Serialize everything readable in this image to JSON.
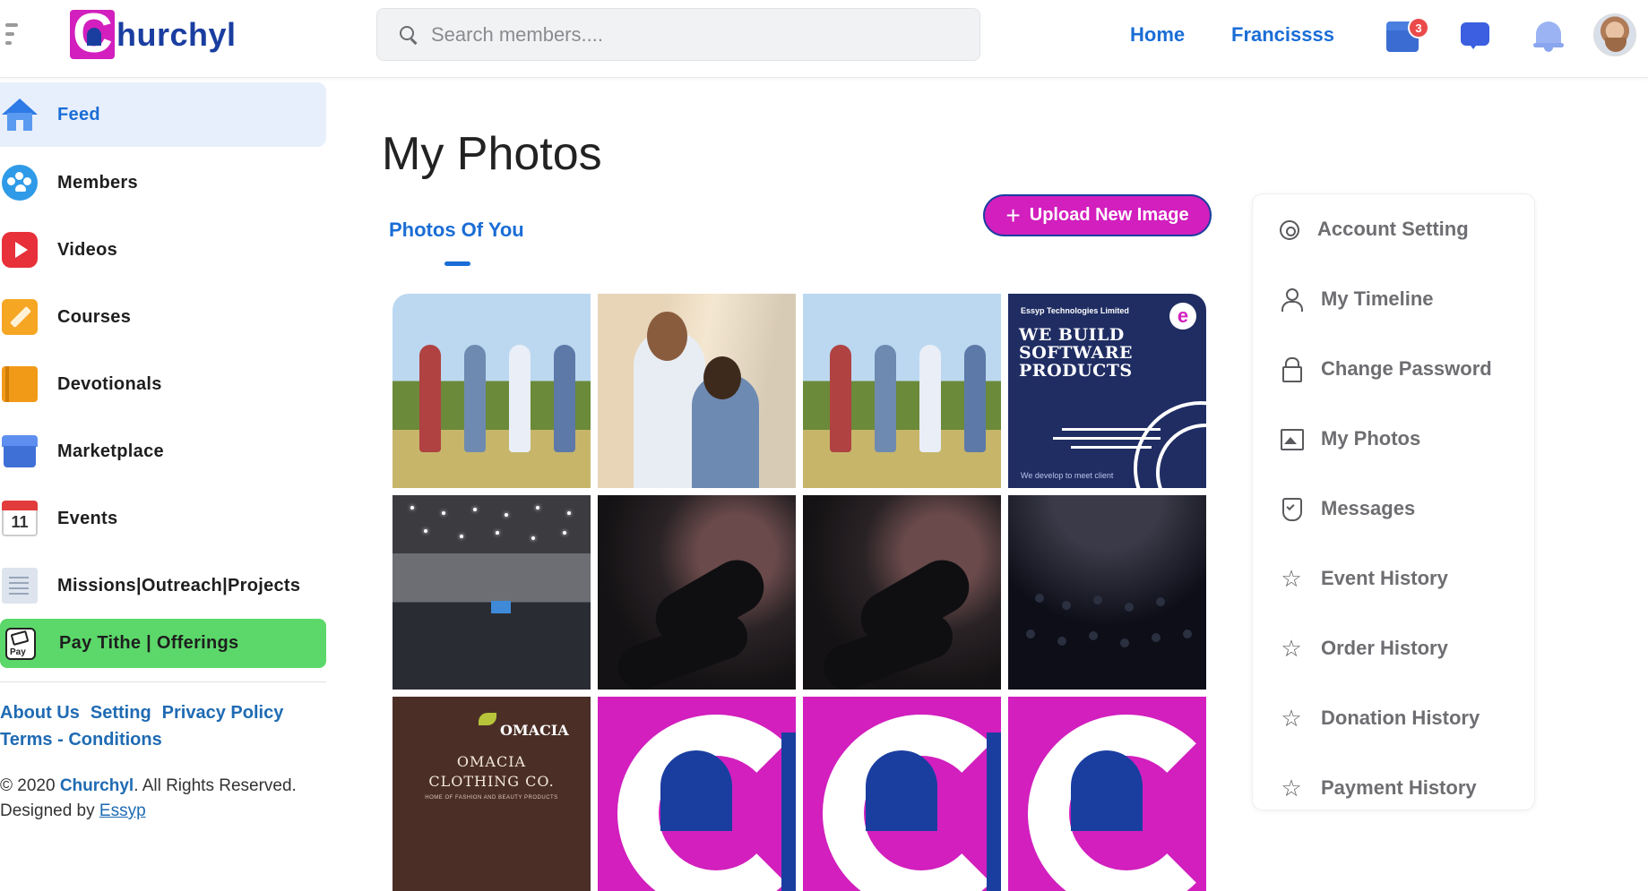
{
  "header": {
    "logo_text": "hurchyl",
    "logo_initial": "C",
    "search_placeholder": "Search members....",
    "nav": {
      "home": "Home",
      "user": "Francissss"
    },
    "store_badge_count": "3"
  },
  "sidebar": {
    "items": [
      {
        "label": "Feed",
        "icon": "home-icon"
      },
      {
        "label": "Members",
        "icon": "members-icon"
      },
      {
        "label": "Videos",
        "icon": "videos-icon"
      },
      {
        "label": "Courses",
        "icon": "courses-icon"
      },
      {
        "label": "Devotionals",
        "icon": "book-icon"
      },
      {
        "label": "Marketplace",
        "icon": "store-icon"
      },
      {
        "label": "Events",
        "icon": "calendar-icon",
        "calendar_day": "11"
      },
      {
        "label": "Missions|Outreach|Projects",
        "icon": "document-icon"
      },
      {
        "label": "Pay Tithe | Offerings",
        "icon": "pay-icon",
        "icon_text": "Pay"
      }
    ],
    "footer_links": [
      "About Us",
      "Setting",
      "Privacy Policy",
      "Terms - Conditions"
    ],
    "copyright_prefix": "© 2020",
    "copyright_brand": "Churchyl",
    "copyright_suffix": ". All Rights Reserved.",
    "designed_by_prefix": "Designed by",
    "designed_by_link": "Essyp"
  },
  "main": {
    "title": "My Photos",
    "tab_label": "Photos Of You",
    "upload_button": "Upload New Image",
    "photo_texts": {
      "ad_company": "Essyp Technologies Limited",
      "ad_headline_1": "WE BUILD",
      "ad_headline_2": "SOFTWARE",
      "ad_headline_3": "PRODUCTS",
      "ad_sub": "We develop to meet client",
      "omacia_logo": "OMACIA",
      "omacia_line_1": "OMACIA",
      "omacia_line_2": "CLOTHING CO.",
      "omacia_tagline": "HOME OF FASHION AND BEAUTY PRODUCTS"
    }
  },
  "account_menu": {
    "items": [
      {
        "label": "Account Setting",
        "icon": "gear-icon"
      },
      {
        "label": "My Timeline",
        "icon": "user-icon"
      },
      {
        "label": "Change Password",
        "icon": "lock-icon"
      },
      {
        "label": "My Photos",
        "icon": "image-icon"
      },
      {
        "label": "Messages",
        "icon": "shield-icon"
      },
      {
        "label": "Event History",
        "icon": "star-icon"
      },
      {
        "label": "Order History",
        "icon": "star-icon"
      },
      {
        "label": "Donation History",
        "icon": "star-icon"
      },
      {
        "label": "Payment History",
        "icon": "star-icon"
      }
    ]
  },
  "colors": {
    "brand_magenta": "#d21fbe",
    "brand_blue": "#1a3ea0",
    "link_blue": "#1a6dd6",
    "pay_green": "#5cd86a"
  }
}
